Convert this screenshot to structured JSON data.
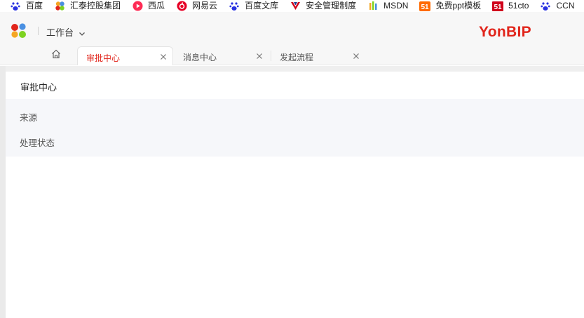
{
  "bookmarks": [
    {
      "label": "百度",
      "icon": "baidu-paw-icon",
      "color": "#2932e1"
    },
    {
      "label": "汇泰控股集团",
      "icon": "colorful-petals-icon",
      "color": "#f5a623"
    },
    {
      "label": "西瓜",
      "icon": "xigua-play-icon",
      "color": "#fe2c55"
    },
    {
      "label": "网易云",
      "icon": "netease-music-icon",
      "color": "#e60026"
    },
    {
      "label": "百度文库",
      "icon": "baidu-paw-icon",
      "color": "#2932e1"
    },
    {
      "label": "安全管理制度",
      "icon": "v-shield-icon",
      "color": "#d0021b"
    },
    {
      "label": "MSDN",
      "icon": "msdn-icon",
      "color": "#f5a623"
    },
    {
      "label": "免费ppt模板",
      "icon": "51-ppt-icon",
      "color": "#ff6a00"
    },
    {
      "label": "51cto",
      "icon": "51cto-icon",
      "color": "#d0021b"
    },
    {
      "label": "CCN",
      "icon": "baidu-paw-icon",
      "color": "#2932e1"
    }
  ],
  "header": {
    "workbench_label": "工作台",
    "brand": "YonBIP",
    "brand_color": "#e1251b"
  },
  "tabs": [
    {
      "label": "审批中心",
      "active": true
    },
    {
      "label": "消息中心",
      "active": false
    },
    {
      "label": "发起流程",
      "active": false
    }
  ],
  "page": {
    "title": "审批中心",
    "filters": [
      {
        "label": "来源"
      },
      {
        "label": "处理状态"
      }
    ]
  }
}
